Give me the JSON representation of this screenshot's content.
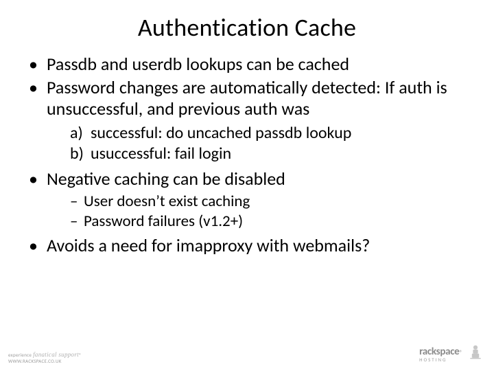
{
  "title": "Authentication Cache",
  "bullets": [
    {
      "text": "Passdb and userdb lookups can be cached"
    },
    {
      "text": "Password changes are automatically detected: If auth is unsuccessful, and previous auth was",
      "letters": [
        "successful: do uncached passdb lookup",
        "usuccessful: fail login"
      ]
    },
    {
      "text": "Negative caching can be disabled",
      "dashes": [
        "User doesn’t exist caching",
        "Password failures (v1.2+)"
      ]
    },
    {
      "text": "Avoids a need for imapproxy with webmails?"
    }
  ],
  "footer": {
    "left_line1": "experience fanatical support",
    "left_line2": "WWW.RACKSPACE.CO.UK",
    "brand": "rackspace",
    "sub": "HOSTING"
  }
}
